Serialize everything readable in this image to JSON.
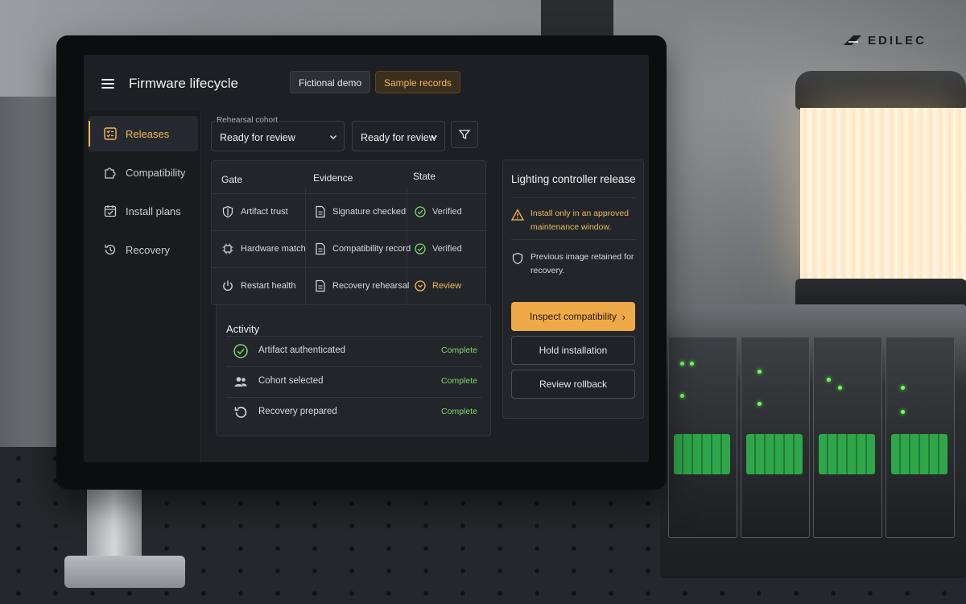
{
  "brand": {
    "name": "EDILEC"
  },
  "app": {
    "title": "Firmware lifecycle",
    "chips": {
      "demo": "Fictional demo",
      "sample": "Sample records"
    }
  },
  "sidebar": {
    "items": [
      {
        "label": "Releases",
        "icon": "checklist-icon",
        "active": true
      },
      {
        "label": "Compatibility",
        "icon": "puzzle-icon",
        "active": false
      },
      {
        "label": "Install plans",
        "icon": "calendar-check-icon",
        "active": false
      },
      {
        "label": "Recovery",
        "icon": "history-icon",
        "active": false
      }
    ]
  },
  "filters": {
    "cohort_legend": "Rehearsal cohort",
    "cohort_value": "Ready for review",
    "status_value": "Ready for review"
  },
  "gates": {
    "headers": {
      "gate": "Gate",
      "evidence": "Evidence",
      "state": "State"
    },
    "rows": [
      {
        "gate": "Artifact trust",
        "gate_icon": "shield-icon",
        "evidence": "Signature checked",
        "state": "Verified",
        "state_kind": "ok"
      },
      {
        "gate": "Hardware match",
        "gate_icon": "chip-icon",
        "evidence": "Compatibility record",
        "state": "Verified",
        "state_kind": "ok"
      },
      {
        "gate": "Restart health",
        "gate_icon": "power-icon",
        "evidence": "Recovery rehearsal",
        "state": "Review",
        "state_kind": "review"
      }
    ]
  },
  "activity": {
    "title": "Activity",
    "items": [
      {
        "label": "Artifact authenticated",
        "status": "Complete",
        "icon": "check-circle-icon"
      },
      {
        "label": "Cohort selected",
        "status": "Complete",
        "icon": "users-icon"
      },
      {
        "label": "Recovery prepared",
        "status": "Complete",
        "icon": "restore-icon"
      }
    ]
  },
  "panel": {
    "title": "Lighting controller release",
    "warning": "Install only in an approved maintenance window.",
    "info": "Previous image retained for recovery.",
    "buttons": {
      "primary": "Inspect compatibility",
      "hold": "Hold installation",
      "rollback": "Review rollback"
    }
  },
  "colors": {
    "accent": "#efaa48",
    "success": "#7dd66a",
    "background": "#1c1f23"
  }
}
